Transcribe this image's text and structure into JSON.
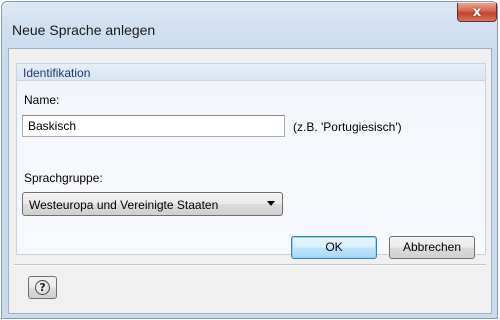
{
  "window": {
    "title": "Neue Sprache anlegen",
    "close_label": "x"
  },
  "group": {
    "title": "Identifikation",
    "name_label": "Name:",
    "name_value": "Baskisch",
    "name_hint": "(z.B. 'Portugiesisch')",
    "language_group_label": "Sprachgruppe:",
    "language_group_value": "Westeuropa und Vereinigte Staaten"
  },
  "footer": {
    "help_glyph": "?",
    "ok_label": "OK",
    "cancel_label": "Abbrechen"
  },
  "icons": {
    "help": "help-icon",
    "close": "close-icon",
    "dropdown": "chevron-down-icon"
  },
  "colors": {
    "title_bar": "#cfdff1",
    "close_button": "#c2412a",
    "group_title": "#1f3a6b",
    "default_button_border": "#3c7fb1"
  }
}
